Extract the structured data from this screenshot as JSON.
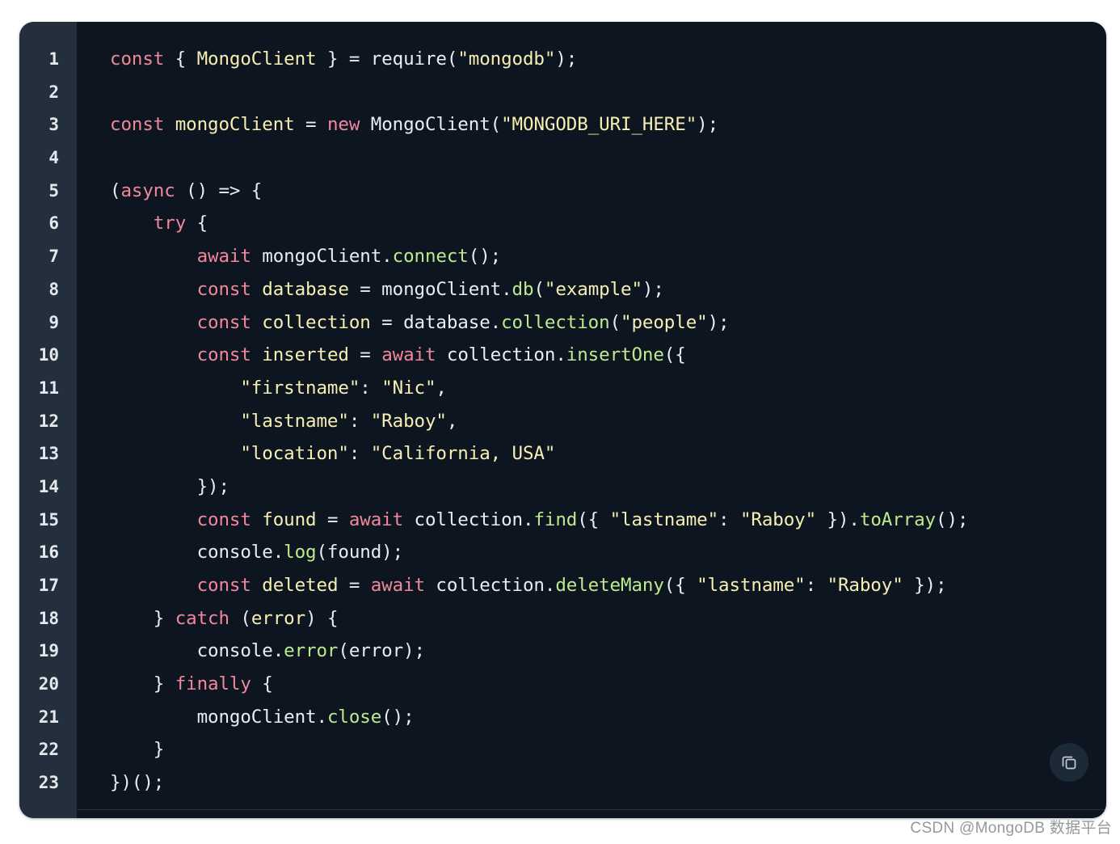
{
  "window": {
    "background_color": "#ffffff",
    "card_background": "#0d1620",
    "gutter_background": "#242f3d"
  },
  "theme": {
    "keyword_color": "#f2879b",
    "string_color": "#f7efb2",
    "variable_color": "#f7efb2",
    "function_color": "#bdea8e",
    "plain_color": "#e8edf2",
    "lineno_color": "#e4e7eb"
  },
  "code_block": {
    "language": "javascript",
    "first_line_number": 1,
    "last_line_number": 23,
    "line_numbers": [
      "1",
      "2",
      "3",
      "4",
      "5",
      "6",
      "7",
      "8",
      "9",
      "10",
      "11",
      "12",
      "13",
      "14",
      "15",
      "16",
      "17",
      "18",
      "19",
      "20",
      "21",
      "22",
      "23"
    ],
    "plain_text": "const { MongoClient } = require(\"mongodb\");\n\nconst mongoClient = new MongoClient(\"MONGODB_URI_HERE\");\n\n(async () => {\n    try {\n        await mongoClient.connect();\n        const database = mongoClient.db(\"example\");\n        const collection = database.collection(\"people\");\n        const inserted = await collection.insertOne({\n            \"firstname\": \"Nic\",\n            \"lastname\": \"Raboy\",\n            \"location\": \"California, USA\"\n        });\n        const found = await collection.find({ \"lastname\": \"Raboy\" }).toArray();\n        console.log(found);\n        const deleted = await collection.deleteMany({ \"lastname\": \"Raboy\" });\n    } catch (error) {\n        console.error(error);\n    } finally {\n        mongoClient.close();\n    }\n})();",
    "lines": [
      {
        "n": "1",
        "tokens": [
          {
            "t": "const",
            "c": "k"
          },
          {
            "t": " { ",
            "c": "p"
          },
          {
            "t": "MongoClient",
            "c": "v"
          },
          {
            "t": " } = ",
            "c": "p"
          },
          {
            "t": "require",
            "c": "p"
          },
          {
            "t": "(",
            "c": "p"
          },
          {
            "t": "\"mongodb\"",
            "c": "s"
          },
          {
            "t": ");",
            "c": "p"
          }
        ]
      },
      {
        "n": "2",
        "tokens": []
      },
      {
        "n": "3",
        "tokens": [
          {
            "t": "const",
            "c": "k"
          },
          {
            "t": " ",
            "c": "p"
          },
          {
            "t": "mongoClient",
            "c": "v"
          },
          {
            "t": " = ",
            "c": "p"
          },
          {
            "t": "new",
            "c": "k"
          },
          {
            "t": " MongoClient(",
            "c": "p"
          },
          {
            "t": "\"MONGODB_URI_HERE\"",
            "c": "s"
          },
          {
            "t": ");",
            "c": "p"
          }
        ]
      },
      {
        "n": "4",
        "tokens": []
      },
      {
        "n": "5",
        "tokens": [
          {
            "t": "(",
            "c": "p"
          },
          {
            "t": "async",
            "c": "k"
          },
          {
            "t": " () => {",
            "c": "p"
          }
        ]
      },
      {
        "n": "6",
        "tokens": [
          {
            "t": "    ",
            "c": "p"
          },
          {
            "t": "try",
            "c": "k"
          },
          {
            "t": " {",
            "c": "p"
          }
        ]
      },
      {
        "n": "7",
        "tokens": [
          {
            "t": "        ",
            "c": "p"
          },
          {
            "t": "await",
            "c": "k"
          },
          {
            "t": " mongoClient.",
            "c": "p"
          },
          {
            "t": "connect",
            "c": "f"
          },
          {
            "t": "();",
            "c": "p"
          }
        ]
      },
      {
        "n": "8",
        "tokens": [
          {
            "t": "        ",
            "c": "p"
          },
          {
            "t": "const",
            "c": "k"
          },
          {
            "t": " ",
            "c": "p"
          },
          {
            "t": "database",
            "c": "v"
          },
          {
            "t": " = mongoClient.",
            "c": "p"
          },
          {
            "t": "db",
            "c": "f"
          },
          {
            "t": "(",
            "c": "p"
          },
          {
            "t": "\"example\"",
            "c": "s"
          },
          {
            "t": ");",
            "c": "p"
          }
        ]
      },
      {
        "n": "9",
        "tokens": [
          {
            "t": "        ",
            "c": "p"
          },
          {
            "t": "const",
            "c": "k"
          },
          {
            "t": " ",
            "c": "p"
          },
          {
            "t": "collection",
            "c": "v"
          },
          {
            "t": " = database.",
            "c": "p"
          },
          {
            "t": "collection",
            "c": "f"
          },
          {
            "t": "(",
            "c": "p"
          },
          {
            "t": "\"people\"",
            "c": "s"
          },
          {
            "t": ");",
            "c": "p"
          }
        ]
      },
      {
        "n": "10",
        "tokens": [
          {
            "t": "        ",
            "c": "p"
          },
          {
            "t": "const",
            "c": "k"
          },
          {
            "t": " ",
            "c": "p"
          },
          {
            "t": "inserted",
            "c": "v"
          },
          {
            "t": " = ",
            "c": "p"
          },
          {
            "t": "await",
            "c": "k"
          },
          {
            "t": " collection.",
            "c": "p"
          },
          {
            "t": "insertOne",
            "c": "f"
          },
          {
            "t": "({",
            "c": "p"
          }
        ]
      },
      {
        "n": "11",
        "tokens": [
          {
            "t": "            ",
            "c": "p"
          },
          {
            "t": "\"firstname\"",
            "c": "s"
          },
          {
            "t": ": ",
            "c": "p"
          },
          {
            "t": "\"Nic\"",
            "c": "s"
          },
          {
            "t": ",",
            "c": "p"
          }
        ]
      },
      {
        "n": "12",
        "tokens": [
          {
            "t": "            ",
            "c": "p"
          },
          {
            "t": "\"lastname\"",
            "c": "s"
          },
          {
            "t": ": ",
            "c": "p"
          },
          {
            "t": "\"Raboy\"",
            "c": "s"
          },
          {
            "t": ",",
            "c": "p"
          }
        ]
      },
      {
        "n": "13",
        "tokens": [
          {
            "t": "            ",
            "c": "p"
          },
          {
            "t": "\"location\"",
            "c": "s"
          },
          {
            "t": ": ",
            "c": "p"
          },
          {
            "t": "\"California, USA\"",
            "c": "s"
          }
        ]
      },
      {
        "n": "14",
        "tokens": [
          {
            "t": "        });",
            "c": "p"
          }
        ]
      },
      {
        "n": "15",
        "tokens": [
          {
            "t": "        ",
            "c": "p"
          },
          {
            "t": "const",
            "c": "k"
          },
          {
            "t": " ",
            "c": "p"
          },
          {
            "t": "found",
            "c": "v"
          },
          {
            "t": " = ",
            "c": "p"
          },
          {
            "t": "await",
            "c": "k"
          },
          {
            "t": " collection.",
            "c": "p"
          },
          {
            "t": "find",
            "c": "f"
          },
          {
            "t": "({ ",
            "c": "p"
          },
          {
            "t": "\"lastname\"",
            "c": "s"
          },
          {
            "t": ": ",
            "c": "p"
          },
          {
            "t": "\"Raboy\"",
            "c": "s"
          },
          {
            "t": " }).",
            "c": "p"
          },
          {
            "t": "toArray",
            "c": "f"
          },
          {
            "t": "();",
            "c": "p"
          }
        ]
      },
      {
        "n": "16",
        "tokens": [
          {
            "t": "        console.",
            "c": "p"
          },
          {
            "t": "log",
            "c": "f"
          },
          {
            "t": "(found);",
            "c": "p"
          }
        ]
      },
      {
        "n": "17",
        "tokens": [
          {
            "t": "        ",
            "c": "p"
          },
          {
            "t": "const",
            "c": "k"
          },
          {
            "t": " ",
            "c": "p"
          },
          {
            "t": "deleted",
            "c": "v"
          },
          {
            "t": " = ",
            "c": "p"
          },
          {
            "t": "await",
            "c": "k"
          },
          {
            "t": " collection.",
            "c": "p"
          },
          {
            "t": "deleteMany",
            "c": "f"
          },
          {
            "t": "({ ",
            "c": "p"
          },
          {
            "t": "\"lastname\"",
            "c": "s"
          },
          {
            "t": ": ",
            "c": "p"
          },
          {
            "t": "\"Raboy\"",
            "c": "s"
          },
          {
            "t": " });",
            "c": "p"
          }
        ]
      },
      {
        "n": "18",
        "tokens": [
          {
            "t": "    } ",
            "c": "p"
          },
          {
            "t": "catch",
            "c": "k"
          },
          {
            "t": " (",
            "c": "p"
          },
          {
            "t": "error",
            "c": "v"
          },
          {
            "t": ") {",
            "c": "p"
          }
        ]
      },
      {
        "n": "19",
        "tokens": [
          {
            "t": "        console.",
            "c": "p"
          },
          {
            "t": "error",
            "c": "f"
          },
          {
            "t": "(error);",
            "c": "p"
          }
        ]
      },
      {
        "n": "20",
        "tokens": [
          {
            "t": "    } ",
            "c": "p"
          },
          {
            "t": "finally",
            "c": "k"
          },
          {
            "t": " {",
            "c": "p"
          }
        ]
      },
      {
        "n": "21",
        "tokens": [
          {
            "t": "        mongoClient.",
            "c": "p"
          },
          {
            "t": "close",
            "c": "f"
          },
          {
            "t": "();",
            "c": "p"
          }
        ]
      },
      {
        "n": "22",
        "tokens": [
          {
            "t": "    }",
            "c": "p"
          }
        ]
      },
      {
        "n": "23",
        "tokens": [
          {
            "t": "})();",
            "c": "p"
          }
        ]
      }
    ]
  },
  "copy_button": {
    "icon": "copy-icon",
    "label": ""
  },
  "watermark": {
    "text": "CSDN @MongoDB 数据平台"
  }
}
